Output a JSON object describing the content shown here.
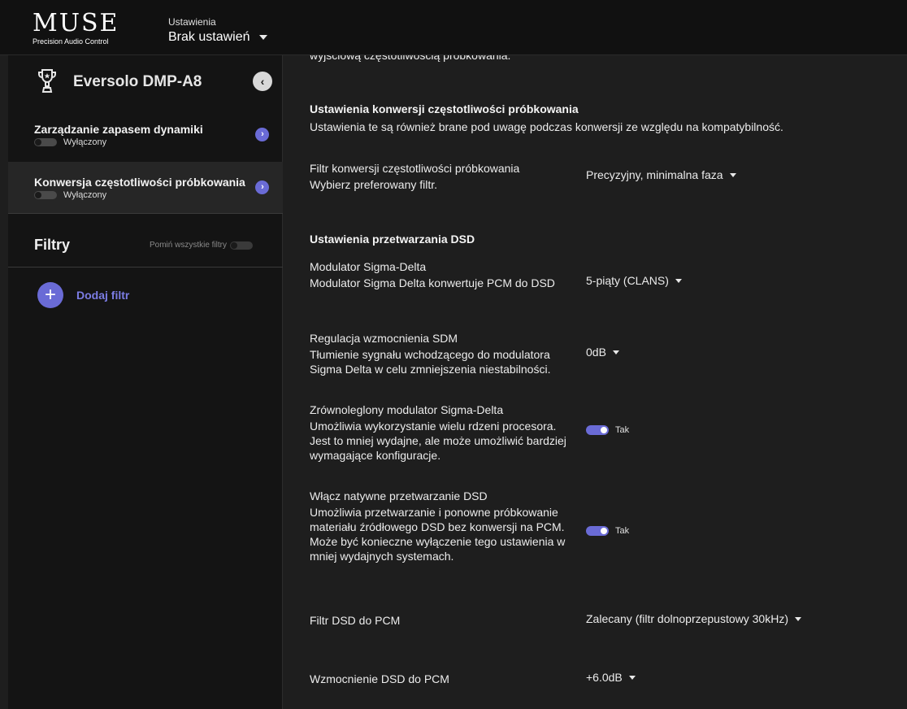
{
  "header": {
    "logo_main": "MUSE",
    "logo_sub": "Precision Audio Control",
    "settings_label": "Ustawienia",
    "settings_value": "Brak ustawień"
  },
  "sidebar": {
    "device_name": "Eversolo DMP-A8",
    "items": [
      {
        "label": "Zarządzanie zapasem dynamiki",
        "status": "Wyłączony"
      },
      {
        "label": "Konwersja częstotliwości próbkowania",
        "status": "Wyłączony"
      }
    ],
    "filters_title": "Filtry",
    "skip_filters_label": "Pomiń wszystkie filtry",
    "add_filter_label": "Dodaj filtr"
  },
  "main": {
    "cut_top_text": "wyjściową częstotliwością próbkowania.",
    "src_section": {
      "title": "Ustawienia konwersji częstotliwości próbkowania",
      "description": "Ustawienia te są również brane pod uwagę podczas konwersji ze względu na kompatybilność."
    },
    "src_filter": {
      "label": "Filtr konwersji częstotliwości próbkowania",
      "description": "Wybierz preferowany filtr.",
      "value": "Precyzyjny, minimalna faza"
    },
    "dsd_section": {
      "title": "Ustawienia przetwarzania DSD"
    },
    "sigma_delta": {
      "label": "Modulator Sigma-Delta",
      "description": "Modulator Sigma Delta konwertuje PCM do DSD",
      "value": "5-piąty (CLANS)"
    },
    "sdm_gain": {
      "label": "Regulacja wzmocnienia SDM",
      "description": "Tłumienie sygnału wchodzącego do modulatora Sigma Delta w celu zmniejszenia niestabilności.",
      "value": "0dB"
    },
    "parallel": {
      "label": "Zrównoleglony modulator Sigma-Delta",
      "description": "Umożliwia wykorzystanie wielu rdzeni procesora. Jest to mniej wydajne, ale może umożliwić bardziej wymagające konfiguracje.",
      "toggle_label": "Tak"
    },
    "native_dsd": {
      "label": "Włącz natywne przetwarzanie DSD",
      "description": "Umożliwia przetwarzanie i ponowne próbkowanie materiału źródłowego DSD bez konwersji na PCM. Może być konieczne wyłączenie tego ustawienia w mniej wydajnych systemach.",
      "toggle_label": "Tak"
    },
    "dsd_pcm_filter": {
      "label": "Filtr DSD do PCM",
      "value": "Zalecany (filtr dolnoprzepustowy 30kHz)"
    },
    "dsd_pcm_gain": {
      "label": "Wzmocnienie DSD do PCM",
      "value": "+6.0dB"
    }
  },
  "colors": {
    "accent": "#6a6bd6",
    "background": "#1e1e1e",
    "sidebar": "#141414",
    "topbar": "#111111"
  }
}
